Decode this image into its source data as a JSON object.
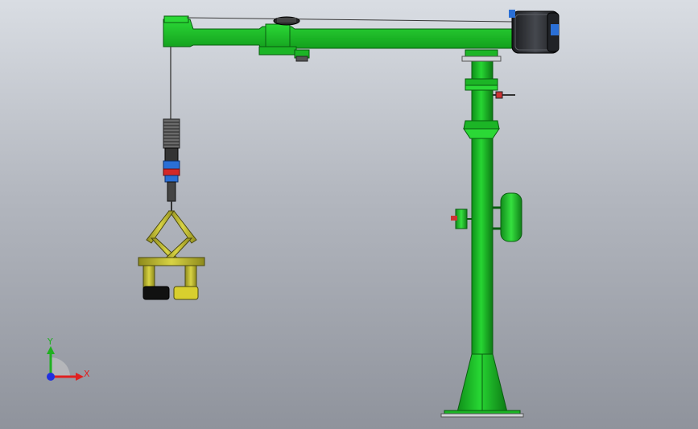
{
  "viewport": {
    "background_top": "#d9dde3",
    "background_bottom": "#8f939c"
  },
  "model": {
    "frame_color": "#1fc62a",
    "frame_dark": "#0d7a14",
    "motor_color": "#2b2d31",
    "accent_blue": "#2a6fd6",
    "accent_red": "#d42828",
    "gripper_color": "#b7b32a",
    "pad_color": "#111111"
  },
  "triad": {
    "x_label": "X",
    "y_label": "Y",
    "x_color": "#e02020",
    "y_color": "#20b020",
    "z_color": "#2030e0"
  }
}
